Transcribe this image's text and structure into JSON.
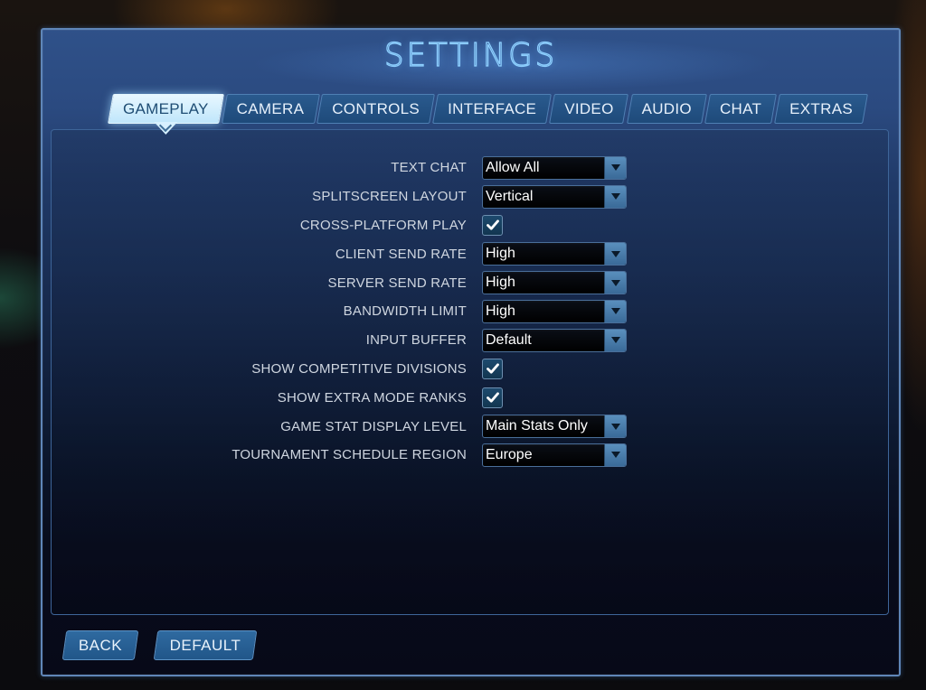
{
  "window": {
    "title": "SETTINGS"
  },
  "tabs": [
    {
      "label": "GAMEPLAY",
      "active": true
    },
    {
      "label": "CAMERA",
      "active": false
    },
    {
      "label": "CONTROLS",
      "active": false
    },
    {
      "label": "INTERFACE",
      "active": false
    },
    {
      "label": "VIDEO",
      "active": false
    },
    {
      "label": "AUDIO",
      "active": false
    },
    {
      "label": "CHAT",
      "active": false
    },
    {
      "label": "EXTRAS",
      "active": false
    }
  ],
  "settings": [
    {
      "label": "TEXT CHAT",
      "type": "dropdown",
      "value": "Allow All"
    },
    {
      "label": "SPLITSCREEN LAYOUT",
      "type": "dropdown",
      "value": "Vertical"
    },
    {
      "label": "CROSS-PLATFORM PLAY",
      "type": "checkbox",
      "checked": true
    },
    {
      "label": "CLIENT SEND RATE",
      "type": "dropdown",
      "value": "High"
    },
    {
      "label": "SERVER SEND RATE",
      "type": "dropdown",
      "value": "High"
    },
    {
      "label": "BANDWIDTH LIMIT",
      "type": "dropdown",
      "value": "High"
    },
    {
      "label": "INPUT BUFFER",
      "type": "dropdown",
      "value": "Default"
    },
    {
      "label": "SHOW COMPETITIVE DIVISIONS",
      "type": "checkbox",
      "checked": true
    },
    {
      "label": "SHOW EXTRA MODE RANKS",
      "type": "checkbox",
      "checked": true
    },
    {
      "label": "GAME STAT DISPLAY LEVEL",
      "type": "dropdown",
      "value": "Main Stats Only"
    },
    {
      "label": "TOURNAMENT SCHEDULE REGION",
      "type": "dropdown",
      "value": "Europe"
    }
  ],
  "footer": {
    "back_label": "BACK",
    "default_label": "DEFAULT"
  },
  "icons": {
    "dropdown_arrow": "triangle-down",
    "checkbox_mark": "checkmark",
    "tab_pointer": "chevron-down"
  },
  "colors": {
    "accent": "#8ed0ff",
    "active_tab": "#d6f0ff",
    "panel_border": "#5f86b8",
    "button": "#2a619a"
  }
}
